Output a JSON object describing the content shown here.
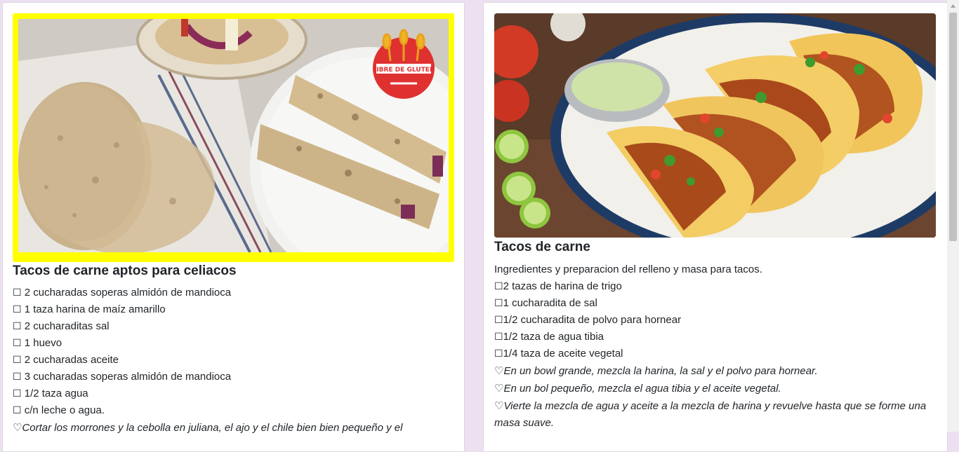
{
  "recipes": [
    {
      "title": "Tacos de carne aptos para celiacos",
      "badge": "LIBRE DE GLUTEN",
      "ingredients": [
        "2 cucharadas soperas almidón de mandioca",
        "1 taza harina de maíz amarillo",
        "2 cucharaditas sal",
        "1 huevo",
        "2 cucharadas aceite",
        "3 cucharadas soperas almidón de mandioca",
        "1/2 taza agua",
        "c/n leche o agua."
      ],
      "steps": [
        "Cortar los morrones y la cebolla en juliana, el ajo y el chile bien bien pequeño y el"
      ]
    },
    {
      "title": "Tacos de carne",
      "intro": "Ingredientes y preparacion del relleno y masa para tacos.",
      "ingredients": [
        "2 tazas de harina de trigo",
        "1 cucharadita de sal",
        "1/2 cucharadita de polvo para hornear",
        "1/2 taza de agua tibia",
        "1/4 taza de aceite vegetal"
      ],
      "steps": [
        "En un bowl grande, mezcla la harina, la sal y el polvo para hornear.",
        "En un bol pequeño, mezcla el agua tibia y el aceite vegetal.",
        "Vierte la mezcla de agua y aceite a la mezcla de harina y revuelve hasta que se forme una masa suave."
      ]
    }
  ],
  "colors": {
    "page_background": "#ece0f1",
    "highlight_border": "#ffff00",
    "badge_red": "#e03131"
  },
  "icons": {
    "ingredient_marker": "checkbox-icon",
    "step_marker": "heart-icon"
  }
}
